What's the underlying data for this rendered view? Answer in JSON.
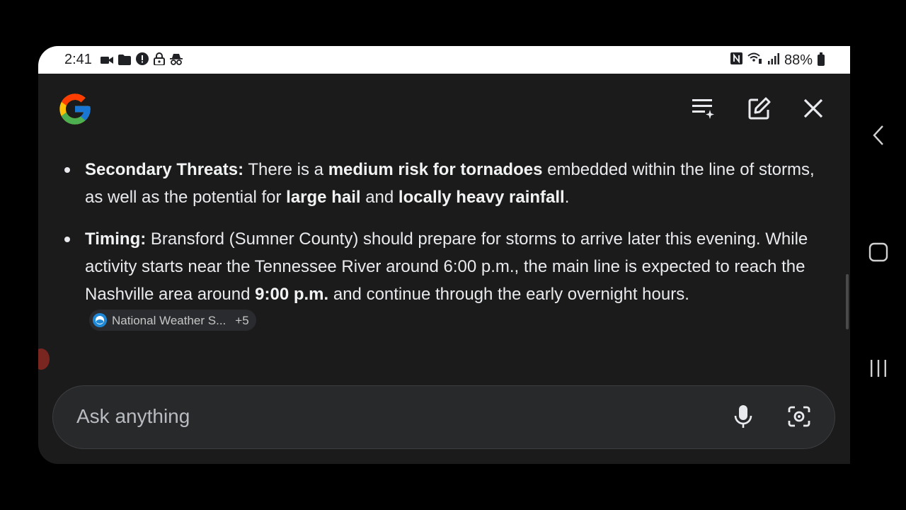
{
  "status_bar": {
    "time": "2:41",
    "battery_text": "88%",
    "left_icons": [
      "video-icon",
      "folder-icon",
      "alert-icon",
      "lock-icon",
      "incognito-icon"
    ],
    "right_icons": [
      "nfc-icon",
      "wifi-calling-icon",
      "signal-icon",
      "battery-icon"
    ]
  },
  "header": {
    "logo": "google-logo",
    "buttons": [
      "history-icon",
      "new-chat-icon",
      "close-icon"
    ]
  },
  "content": {
    "items": [
      {
        "label": "Secondary Threats:",
        "t1": " There is a ",
        "b1": "medium risk for tornadoes",
        "t2": " embedded within the line of storms, as well as the potential for ",
        "b2": "large hail",
        "t3": " and ",
        "b3": "locally heavy rainfall",
        "t4": "."
      },
      {
        "label": "Timing:",
        "t1": " Bransford (Sumner County) should prepare for storms to arrive later this evening. While activity starts near the Tennessee River around 6:00 p.m., the main line is expected to reach the Nashville area around ",
        "b1": "9:00 p.m.",
        "t2": " and continue through the early overnight hours.",
        "source_chip": {
          "text": "National Weather S...",
          "count": "+5"
        }
      }
    ]
  },
  "input": {
    "placeholder": "Ask anything"
  },
  "colors": {
    "background": "#1b1b1b",
    "text": "#e8eaed",
    "input_bg": "#28292b"
  }
}
